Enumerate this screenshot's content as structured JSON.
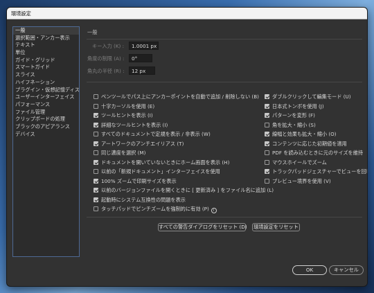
{
  "window": {
    "title": "環境設定"
  },
  "sidebar": {
    "items": [
      {
        "label": "一般"
      },
      {
        "label": "選択範囲・アンカー表示"
      },
      {
        "label": "テキスト"
      },
      {
        "label": "単位"
      },
      {
        "label": "ガイド・グリッド"
      },
      {
        "label": "スマートガイド"
      },
      {
        "label": "スライス"
      },
      {
        "label": "ハイフネーション"
      },
      {
        "label": "プラグイン・仮想記憶ディスク"
      },
      {
        "label": "ユーザーインターフェイス"
      },
      {
        "label": "パフォーマンス"
      },
      {
        "label": "ファイル管理"
      },
      {
        "label": "クリップボードの処理"
      },
      {
        "label": "ブラックのアピアランス"
      },
      {
        "label": "デバイス"
      }
    ]
  },
  "general": {
    "section_title": "一般",
    "fields": {
      "key_increment": {
        "label": "キー入力 (K) :",
        "value": "1.0001 px"
      },
      "constrain_angle": {
        "label": "角度の制限 (A) :",
        "value": "0°"
      },
      "corner_radius": {
        "label": "角丸の半径 (R) :",
        "value": "12 px"
      }
    },
    "left_options": [
      {
        "label": "ペンツールでパス上にアンカーポイントを自動で追加 / 削除しない (B)",
        "checked": false
      },
      {
        "label": "十字カーソルを使用 (E)",
        "checked": false
      },
      {
        "label": "ツールヒントを表示 (I)",
        "checked": true
      },
      {
        "label": "詳細なツールヒントを表示 (I)",
        "checked": true
      },
      {
        "label": "すべてのドキュメントで定規を表示 / 非表示 (W)",
        "checked": false
      },
      {
        "label": "アートワークのアンチエイリアス (T)",
        "checked": true
      },
      {
        "label": "同じ濃度を選択 (M)",
        "checked": false
      },
      {
        "label": "ドキュメントを開いていないときにホーム画面を表示 (H)",
        "checked": true
      },
      {
        "label": "以前の「新規ドキュメント」インターフェイスを使用",
        "checked": false
      },
      {
        "label": "100% ズームで印刷サイズを表示",
        "checked": true
      },
      {
        "label": "以前のバージョンファイルを開くときに [ 更新済み ] をファイル名に追加 (L)",
        "checked": true
      },
      {
        "label": "起動時にシステム互換性の問題を表示",
        "checked": true
      },
      {
        "label": "タッチパッドでピンチズームを強制的に有効 (P)",
        "checked": false
      }
    ],
    "right_options": [
      {
        "label": "ダブルクリックして編集モード (U)",
        "checked": true
      },
      {
        "label": "日本式トンボを使用 (J)",
        "checked": true
      },
      {
        "label": "パターンを変形 (F)",
        "checked": true
      },
      {
        "label": "角を拡大・縮小 (S)",
        "checked": false
      },
      {
        "label": "線幅と効果も拡大・縮小 (O)",
        "checked": true
      },
      {
        "label": "コンテンツに応じた初期値を適用",
        "checked": true
      },
      {
        "label": "PDF を読み込むときに元のサイズを維持",
        "checked": false
      },
      {
        "label": "マウスホイールでズーム",
        "checked": false
      },
      {
        "label": "トラックパッドジェスチャーでビューを回転",
        "checked": true
      },
      {
        "label": "プレビュー境界を使用 (V)",
        "checked": false
      }
    ],
    "reset_warnings_label": "すべての警告ダイアログをリセット (D)",
    "reset_prefs_label": "環境設定をリセット"
  },
  "footer": {
    "ok_label": "OK",
    "cancel_label": "キャンセル"
  }
}
